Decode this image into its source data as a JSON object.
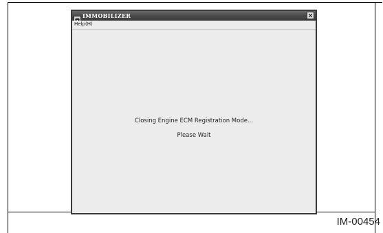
{
  "window": {
    "title": "IMMOBILIZER",
    "icon": "car-app-icon",
    "close_icon": "close-icon"
  },
  "menu": {
    "items": [
      {
        "label": "Help(H)"
      }
    ]
  },
  "content": {
    "message": "Closing Engine ECM Registration Mode...",
    "status": "Please Wait"
  },
  "figure": {
    "id": "IM-00454"
  }
}
